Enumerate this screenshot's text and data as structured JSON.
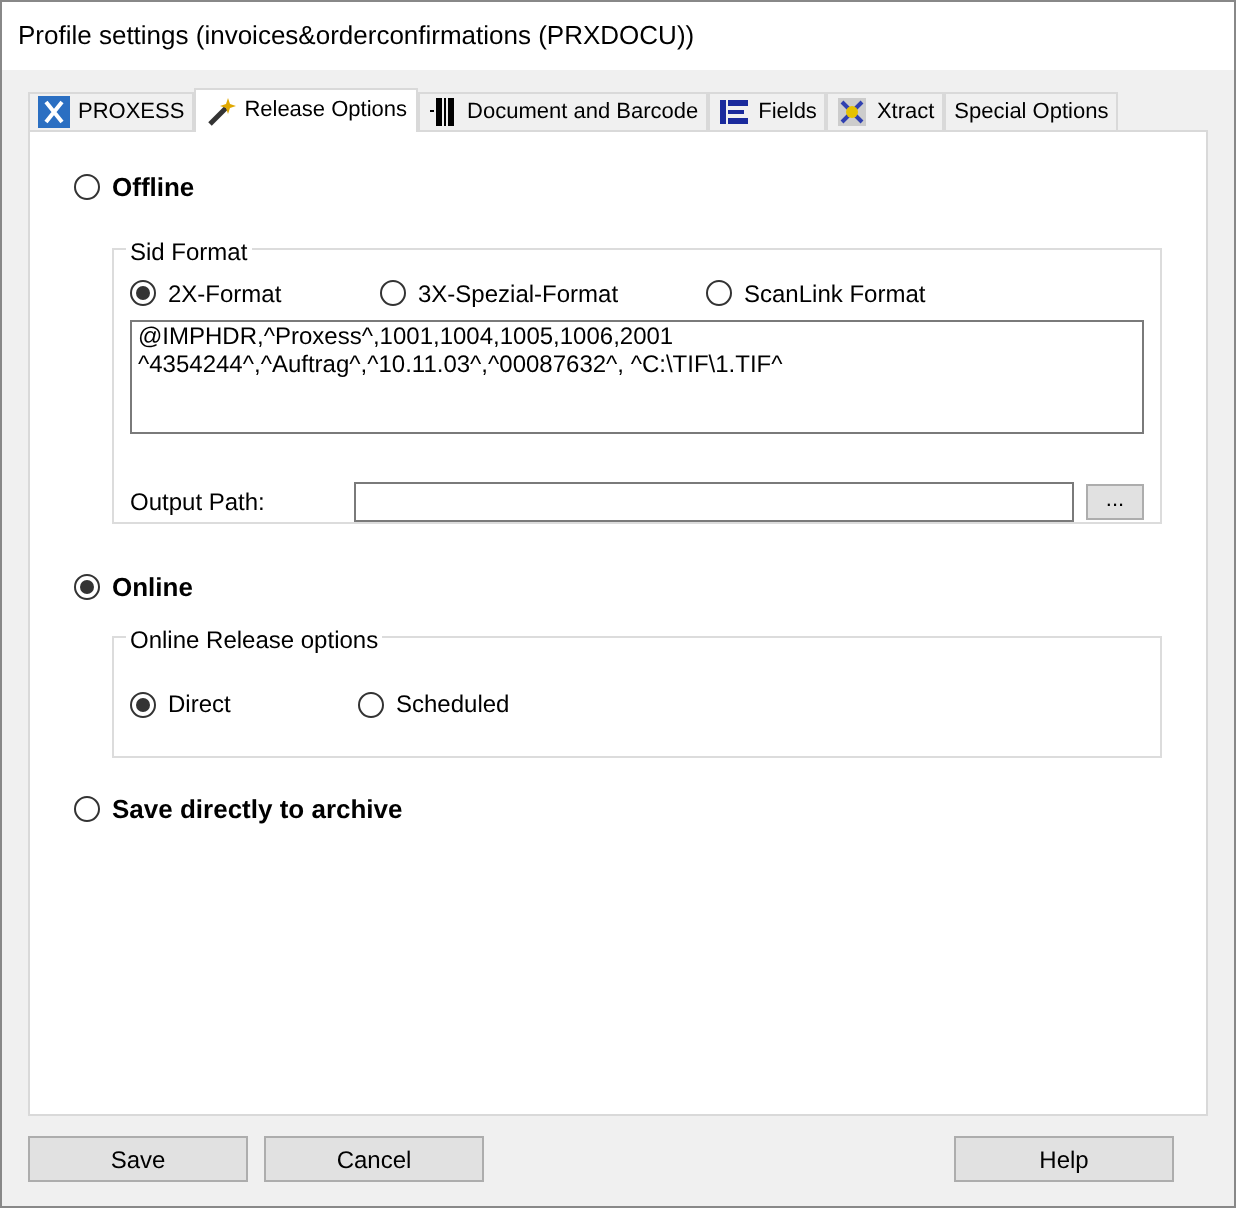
{
  "window": {
    "title": "Profile settings (invoices&orderconfirmations (PRXDOCU))"
  },
  "tabs": [
    {
      "label": "PROXESS",
      "selected": false
    },
    {
      "label": "Release Options",
      "selected": true
    },
    {
      "label": "Document and Barcode",
      "selected": false
    },
    {
      "label": "Fields",
      "selected": false
    },
    {
      "label": "Xtract",
      "selected": false
    },
    {
      "label": "Special Options",
      "selected": false
    }
  ],
  "offline": {
    "label": "Offline",
    "selected": false,
    "sid_format": {
      "title": "Sid Format",
      "options": [
        {
          "label": "2X-Format",
          "selected": true
        },
        {
          "label": "3X-Spezial-Format",
          "selected": false
        },
        {
          "label": "ScanLink Format",
          "selected": false
        }
      ],
      "text": "@IMPHDR,^Proxess^,1001,1004,1005,1006,2001\n^4354244^,^Auftrag^,^10.11.03^,^00087632^, ^C:\\TIF\\1.TIF^",
      "output_path_label": "Output Path:",
      "browse_button": "..."
    }
  },
  "online": {
    "label": "Online",
    "selected": true,
    "release_options": {
      "title": "Online Release options",
      "options": [
        {
          "label": "Direct",
          "selected": true
        },
        {
          "label": "Scheduled",
          "selected": false
        }
      ]
    }
  },
  "archive": {
    "label": "Save directly to archive",
    "selected": false
  },
  "buttons": {
    "save": "Save",
    "cancel": "Cancel",
    "help": "Help"
  }
}
